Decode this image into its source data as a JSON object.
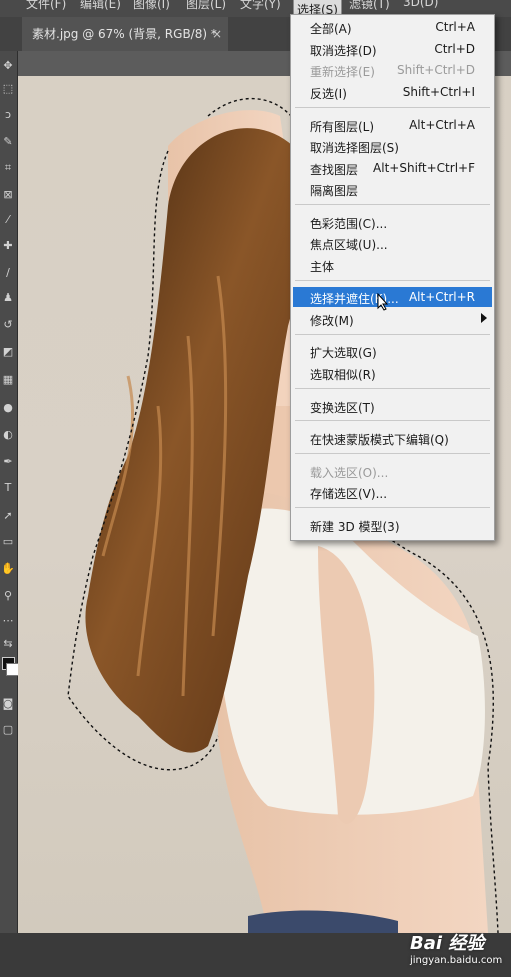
{
  "menubar": {
    "items": [
      "文件(F)",
      "编辑(E)",
      "图像(I)",
      "图层(L)",
      "文字(Y)",
      "选择(S)",
      "滤镜(T)",
      "3D(D)"
    ]
  },
  "document_tab": {
    "title": "素材.jpg @ 67% (背景, RGB/8) *",
    "close": "×"
  },
  "toolbar": {
    "icons": [
      "move-tool-icon",
      "marquee-tool-icon",
      "lasso-tool-icon",
      "quick-select-tool-icon",
      "crop-tool-icon",
      "frame-tool-icon",
      "eyedropper-tool-icon",
      "healing-brush-icon",
      "brush-tool-icon",
      "clone-stamp-icon",
      "history-brush-icon",
      "eraser-tool-icon",
      "gradient-tool-icon",
      "blur-tool-icon",
      "dodge-tool-icon",
      "pen-tool-icon",
      "type-tool-icon",
      "path-select-icon",
      "rectangle-tool-icon",
      "hand-tool-icon",
      "zoom-tool-icon",
      "more-tools-icon",
      "swap-colors-icon",
      "quick-mask-icon",
      "screen-mode-icon"
    ]
  },
  "select_menu": {
    "items": [
      {
        "label": "全部(A)",
        "shortcut": "Ctrl+A",
        "enabled": true
      },
      {
        "label": "取消选择(D)",
        "shortcut": "Ctrl+D",
        "enabled": true
      },
      {
        "label": "重新选择(E)",
        "shortcut": "Shift+Ctrl+D",
        "enabled": false
      },
      {
        "label": "反选(I)",
        "shortcut": "Shift+Ctrl+I",
        "enabled": true
      },
      {
        "label": "所有图层(L)",
        "shortcut": "Alt+Ctrl+A",
        "enabled": true
      },
      {
        "label": "取消选择图层(S)",
        "shortcut": "",
        "enabled": true
      },
      {
        "label": "查找图层",
        "shortcut": "Alt+Shift+Ctrl+F",
        "enabled": true
      },
      {
        "label": "隔离图层",
        "shortcut": "",
        "enabled": true
      },
      {
        "label": "色彩范围(C)...",
        "shortcut": "",
        "enabled": true
      },
      {
        "label": "焦点区域(U)...",
        "shortcut": "",
        "enabled": true
      },
      {
        "label": "主体",
        "shortcut": "",
        "enabled": true
      },
      {
        "label": "选择并遮住(K)...",
        "shortcut": "Alt+Ctrl+R",
        "enabled": true,
        "highlighted": true
      },
      {
        "label": "修改(M)",
        "shortcut": "",
        "enabled": true,
        "submenu": true
      },
      {
        "label": "扩大选取(G)",
        "shortcut": "",
        "enabled": true
      },
      {
        "label": "选取相似(R)",
        "shortcut": "",
        "enabled": true
      },
      {
        "label": "变换选区(T)",
        "shortcut": "",
        "enabled": true
      },
      {
        "label": "在快速蒙版模式下编辑(Q)",
        "shortcut": "",
        "enabled": true
      },
      {
        "label": "载入选区(O)...",
        "shortcut": "",
        "enabled": false
      },
      {
        "label": "存储选区(V)...",
        "shortcut": "",
        "enabled": true
      },
      {
        "label": "新建 3D 模型(3)",
        "shortcut": "",
        "enabled": true
      }
    ]
  },
  "watermark": {
    "logo": "Bai 经验",
    "url": "jingyan.baidu.com"
  },
  "colors": {
    "menu_highlight": "#2a79d4",
    "photo_background": "#d8d0c4",
    "hair": "#6b3f1c"
  }
}
